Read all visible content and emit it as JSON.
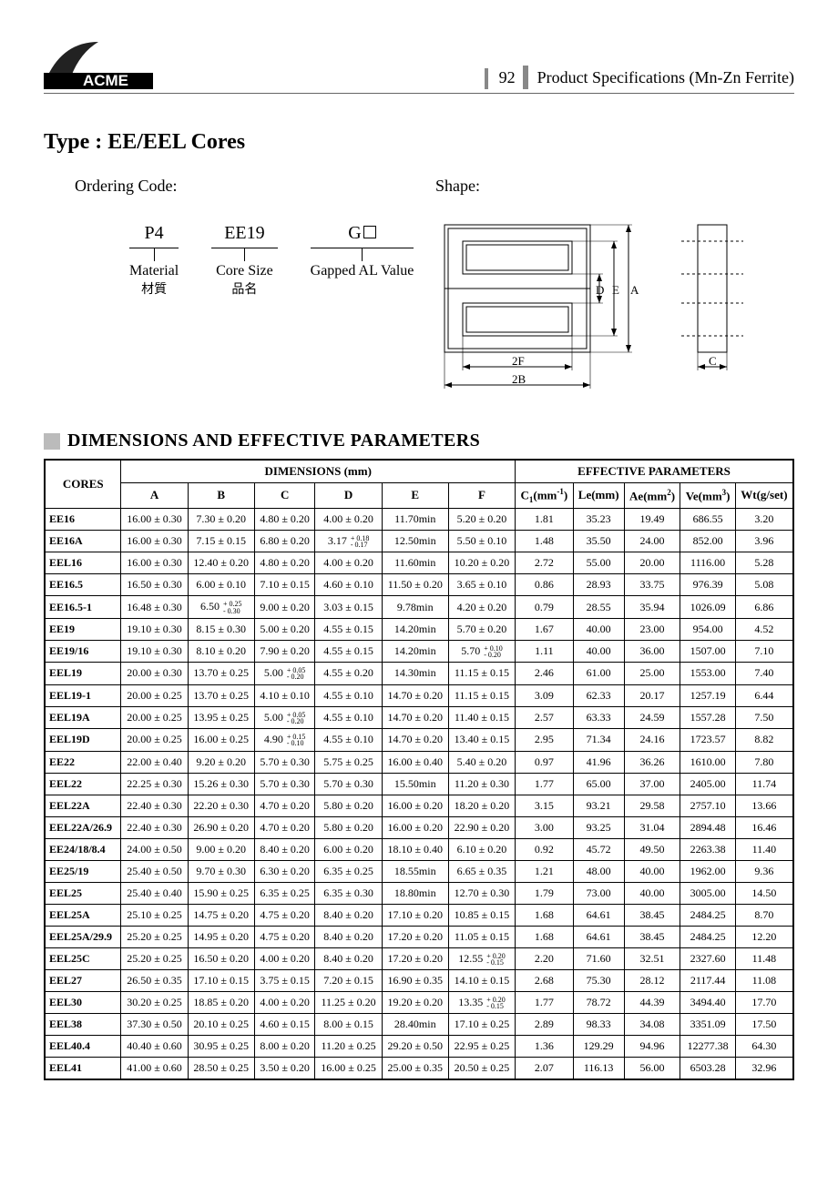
{
  "header": {
    "page_number": "92",
    "title_right": "Product Specifications (Mn-Zn Ferrite)",
    "logo_text": "ACME"
  },
  "title": "Type : EE/EEL Cores",
  "ordering": {
    "heading": "Ordering Code:",
    "cols": [
      {
        "top": "P4",
        "label": "Material",
        "cn": "材質"
      },
      {
        "top": "EE19",
        "label": "Core Size",
        "cn": "品名"
      },
      {
        "top": "G",
        "label": "Gapped AL Value",
        "cn": ""
      }
    ]
  },
  "shape": {
    "heading": "Shape:",
    "labels": {
      "D": "D",
      "E": "E",
      "A": "A",
      "F2": "2F",
      "B2": "2B",
      "C": "C"
    }
  },
  "section_heading": "DIMENSIONS AND EFFECTIVE PARAMETERS",
  "table": {
    "group_dims": "DIMENSIONS (mm)",
    "group_eff": "EFFECTIVE  PARAMETERS",
    "col_cores": "CORES",
    "cols_dims": [
      "A",
      "B",
      "C",
      "D",
      "E",
      "F"
    ],
    "cols_eff": [
      "C₁(mm⁻¹)",
      "Le(mm)",
      "Ae(mm²)",
      "Ve(mm³)",
      "Wt(g/set)"
    ],
    "rows": [
      {
        "core": "EE16",
        "A": "16.00 ± 0.30",
        "B": "7.30 ± 0.20",
        "C": "4.80 ± 0.20",
        "D": "4.00 ± 0.20",
        "E": "11.70min",
        "F": "5.20 ± 0.20",
        "C1": "1.81",
        "Le": "35.23",
        "Ae": "19.49",
        "Ve": "686.55",
        "Wt": "3.20"
      },
      {
        "core": "EE16A",
        "A": "16.00 ± 0.30",
        "B": "7.15 ± 0.15",
        "C": "6.80 ± 0.20",
        "D": {
          "base": "3.17",
          "plus": "+ 0.18",
          "minus": "- 0.17"
        },
        "E": "12.50min",
        "F": "5.50 ± 0.10",
        "C1": "1.48",
        "Le": "35.50",
        "Ae": "24.00",
        "Ve": "852.00",
        "Wt": "3.96"
      },
      {
        "core": "EEL16",
        "A": "16.00 ± 0.30",
        "B": "12.40 ± 0.20",
        "C": "4.80 ± 0.20",
        "D": "4.00 ± 0.20",
        "E": "11.60min",
        "F": "10.20 ± 0.20",
        "C1": "2.72",
        "Le": "55.00",
        "Ae": "20.00",
        "Ve": "1116.00",
        "Wt": "5.28"
      },
      {
        "core": "EE16.5",
        "A": "16.50 ± 0.30",
        "B": "6.00 ± 0.10",
        "C": "7.10 ± 0.15",
        "D": "4.60 ± 0.10",
        "E": "11.50 ± 0.20",
        "F": "3.65 ± 0.10",
        "C1": "0.86",
        "Le": "28.93",
        "Ae": "33.75",
        "Ve": "976.39",
        "Wt": "5.08"
      },
      {
        "core": "EE16.5-1",
        "A": "16.48 ± 0.30",
        "B": {
          "base": "6.50",
          "plus": "+ 0.25",
          "minus": "- 0.30"
        },
        "C": "9.00 ± 0.20",
        "D": "3.03 ± 0.15",
        "E": "9.78min",
        "F": "4.20 ± 0.20",
        "C1": "0.79",
        "Le": "28.55",
        "Ae": "35.94",
        "Ve": "1026.09",
        "Wt": "6.86"
      },
      {
        "core": "EE19",
        "A": "19.10 ± 0.30",
        "B": "8.15 ± 0.30",
        "C": "5.00 ± 0.20",
        "D": "4.55 ± 0.15",
        "E": "14.20min",
        "F": "5.70 ± 0.20",
        "C1": "1.67",
        "Le": "40.00",
        "Ae": "23.00",
        "Ve": "954.00",
        "Wt": "4.52"
      },
      {
        "core": "EE19/16",
        "A": "19.10 ± 0.30",
        "B": "8.10 ± 0.20",
        "C": "7.90 ± 0.20",
        "D": "4.55 ± 0.15",
        "E": "14.20min",
        "F": {
          "base": "5.70",
          "plus": "+ 0.10",
          "minus": "- 0.20"
        },
        "C1": "1.11",
        "Le": "40.00",
        "Ae": "36.00",
        "Ve": "1507.00",
        "Wt": "7.10"
      },
      {
        "core": "EEL19",
        "A": "20.00 ± 0.30",
        "B": "13.70 ± 0.25",
        "C": {
          "base": "5.00",
          "plus": "+ 0.05",
          "minus": "- 0.20"
        },
        "D": "4.55 ± 0.20",
        "E": "14.30min",
        "F": "11.15 ± 0.15",
        "C1": "2.46",
        "Le": "61.00",
        "Ae": "25.00",
        "Ve": "1553.00",
        "Wt": "7.40"
      },
      {
        "core": "EEL19-1",
        "A": "20.00 ± 0.25",
        "B": "13.70 ± 0.25",
        "C": "4.10 ± 0.10",
        "D": "4.55 ± 0.10",
        "E": "14.70 ± 0.20",
        "F": "11.15 ± 0.15",
        "C1": "3.09",
        "Le": "62.33",
        "Ae": "20.17",
        "Ve": "1257.19",
        "Wt": "6.44"
      },
      {
        "core": "EEL19A",
        "A": "20.00 ± 0.25",
        "B": "13.95 ± 0.25",
        "C": {
          "base": "5.00",
          "plus": "+ 0.05",
          "minus": "- 0.20"
        },
        "D": "4.55 ± 0.10",
        "E": "14.70 ± 0.20",
        "F": "11.40 ± 0.15",
        "C1": "2.57",
        "Le": "63.33",
        "Ae": "24.59",
        "Ve": "1557.28",
        "Wt": "7.50"
      },
      {
        "core": "EEL19D",
        "A": "20.00 ± 0.25",
        "B": "16.00 ± 0.25",
        "C": {
          "base": "4.90",
          "plus": "+ 0.15",
          "minus": "- 0.10"
        },
        "D": "4.55 ± 0.10",
        "E": "14.70 ± 0.20",
        "F": "13.40 ± 0.15",
        "C1": "2.95",
        "Le": "71.34",
        "Ae": "24.16",
        "Ve": "1723.57",
        "Wt": "8.82"
      },
      {
        "core": "EE22",
        "A": "22.00 ± 0.40",
        "B": "9.20 ± 0.20",
        "C": "5.70 ± 0.30",
        "D": "5.75 ± 0.25",
        "E": "16.00 ± 0.40",
        "F": "5.40 ± 0.20",
        "C1": "0.97",
        "Le": "41.96",
        "Ae": "36.26",
        "Ve": "1610.00",
        "Wt": "7.80"
      },
      {
        "core": "EEL22",
        "A": "22.25 ± 0.30",
        "B": "15.26 ± 0.30",
        "C": "5.70 ± 0.30",
        "D": "5.70 ± 0.30",
        "E": "15.50min",
        "F": "11.20 ± 0.30",
        "C1": "1.77",
        "Le": "65.00",
        "Ae": "37.00",
        "Ve": "2405.00",
        "Wt": "11.74"
      },
      {
        "core": "EEL22A",
        "A": "22.40 ± 0.30",
        "B": "22.20 ± 0.30",
        "C": "4.70 ± 0.20",
        "D": "5.80 ± 0.20",
        "E": "16.00 ± 0.20",
        "F": "18.20 ± 0.20",
        "C1": "3.15",
        "Le": "93.21",
        "Ae": "29.58",
        "Ve": "2757.10",
        "Wt": "13.66"
      },
      {
        "core": "EEL22A/26.9",
        "A": "22.40 ± 0.30",
        "B": "26.90 ± 0.20",
        "C": "4.70 ± 0.20",
        "D": "5.80 ± 0.20",
        "E": "16.00 ± 0.20",
        "F": "22.90 ± 0.20",
        "C1": "3.00",
        "Le": "93.25",
        "Ae": "31.04",
        "Ve": "2894.48",
        "Wt": "16.46"
      },
      {
        "core": "EE24/18/8.4",
        "A": "24.00 ± 0.50",
        "B": "9.00 ± 0.20",
        "C": "8.40 ± 0.20",
        "D": "6.00 ± 0.20",
        "E": "18.10 ± 0.40",
        "F": "6.10 ± 0.20",
        "C1": "0.92",
        "Le": "45.72",
        "Ae": "49.50",
        "Ve": "2263.38",
        "Wt": "11.40"
      },
      {
        "core": "EE25/19",
        "A": "25.40 ± 0.50",
        "B": "9.70 ± 0.30",
        "C": "6.30 ± 0.20",
        "D": "6.35 ± 0.25",
        "E": "18.55min",
        "F": "6.65 ± 0.35",
        "C1": "1.21",
        "Le": "48.00",
        "Ae": "40.00",
        "Ve": "1962.00",
        "Wt": "9.36"
      },
      {
        "core": "EEL25",
        "A": "25.40 ± 0.40",
        "B": "15.90 ± 0.25",
        "C": "6.35 ± 0.25",
        "D": "6.35 ± 0.30",
        "E": "18.80min",
        "F": "12.70 ± 0.30",
        "C1": "1.79",
        "Le": "73.00",
        "Ae": "40.00",
        "Ve": "3005.00",
        "Wt": "14.50"
      },
      {
        "core": "EEL25A",
        "A": "25.10 ± 0.25",
        "B": "14.75 ± 0.20",
        "C": "4.75 ± 0.20",
        "D": "8.40 ± 0.20",
        "E": "17.10 ± 0.20",
        "F": "10.85 ± 0.15",
        "C1": "1.68",
        "Le": "64.61",
        "Ae": "38.45",
        "Ve": "2484.25",
        "Wt": "8.70"
      },
      {
        "core": "EEL25A/29.9",
        "A": "25.20 ± 0.25",
        "B": "14.95 ± 0.20",
        "C": "4.75 ± 0.20",
        "D": "8.40 ± 0.20",
        "E": "17.20 ± 0.20",
        "F": "11.05 ± 0.15",
        "C1": "1.68",
        "Le": "64.61",
        "Ae": "38.45",
        "Ve": "2484.25",
        "Wt": "12.20"
      },
      {
        "core": "EEL25C",
        "A": "25.20 ± 0.25",
        "B": "16.50 ± 0.20",
        "C": "4.00 ± 0.20",
        "D": "8.40 ± 0.20",
        "E": "17.20 ± 0.20",
        "F": {
          "base": "12.55",
          "plus": "+ 0.20",
          "minus": "- 0.15"
        },
        "C1": "2.20",
        "Le": "71.60",
        "Ae": "32.51",
        "Ve": "2327.60",
        "Wt": "11.48"
      },
      {
        "core": "EEL27",
        "A": "26.50 ± 0.35",
        "B": "17.10 ± 0.15",
        "C": "3.75 ± 0.15",
        "D": "7.20 ± 0.15",
        "E": "16.90 ± 0.35",
        "F": "14.10 ± 0.15",
        "C1": "2.68",
        "Le": "75.30",
        "Ae": "28.12",
        "Ve": "2117.44",
        "Wt": "11.08"
      },
      {
        "core": "EEL30",
        "A": "30.20 ± 0.25",
        "B": "18.85 ± 0.20",
        "C": "4.00 ± 0.20",
        "D": "11.25 ± 0.20",
        "E": "19.20 ± 0.20",
        "F": {
          "base": "13.35",
          "plus": "+ 0.20",
          "minus": "- 0.15"
        },
        "C1": "1.77",
        "Le": "78.72",
        "Ae": "44.39",
        "Ve": "3494.40",
        "Wt": "17.70"
      },
      {
        "core": "EEL38",
        "A": "37.30 ± 0.50",
        "B": "20.10 ± 0.25",
        "C": "4.60 ± 0.15",
        "D": "8.00 ± 0.15",
        "E": "28.40min",
        "F": "17.10 ± 0.25",
        "C1": "2.89",
        "Le": "98.33",
        "Ae": "34.08",
        "Ve": "3351.09",
        "Wt": "17.50"
      },
      {
        "core": "EEL40.4",
        "A": "40.40 ± 0.60",
        "B": "30.95 ± 0.25",
        "C": "8.00 ± 0.20",
        "D": "11.20 ± 0.25",
        "E": "29.20 ± 0.50",
        "F": "22.95 ± 0.25",
        "C1": "1.36",
        "Le": "129.29",
        "Ae": "94.96",
        "Ve": "12277.38",
        "Wt": "64.30"
      },
      {
        "core": "EEL41",
        "A": "41.00 ± 0.60",
        "B": "28.50 ± 0.25",
        "C": "3.50 ± 0.20",
        "D": "16.00 ± 0.25",
        "E": "25.00 ± 0.35",
        "F": "20.50 ± 0.25",
        "C1": "2.07",
        "Le": "116.13",
        "Ae": "56.00",
        "Ve": "6503.28",
        "Wt": "32.96"
      }
    ]
  }
}
